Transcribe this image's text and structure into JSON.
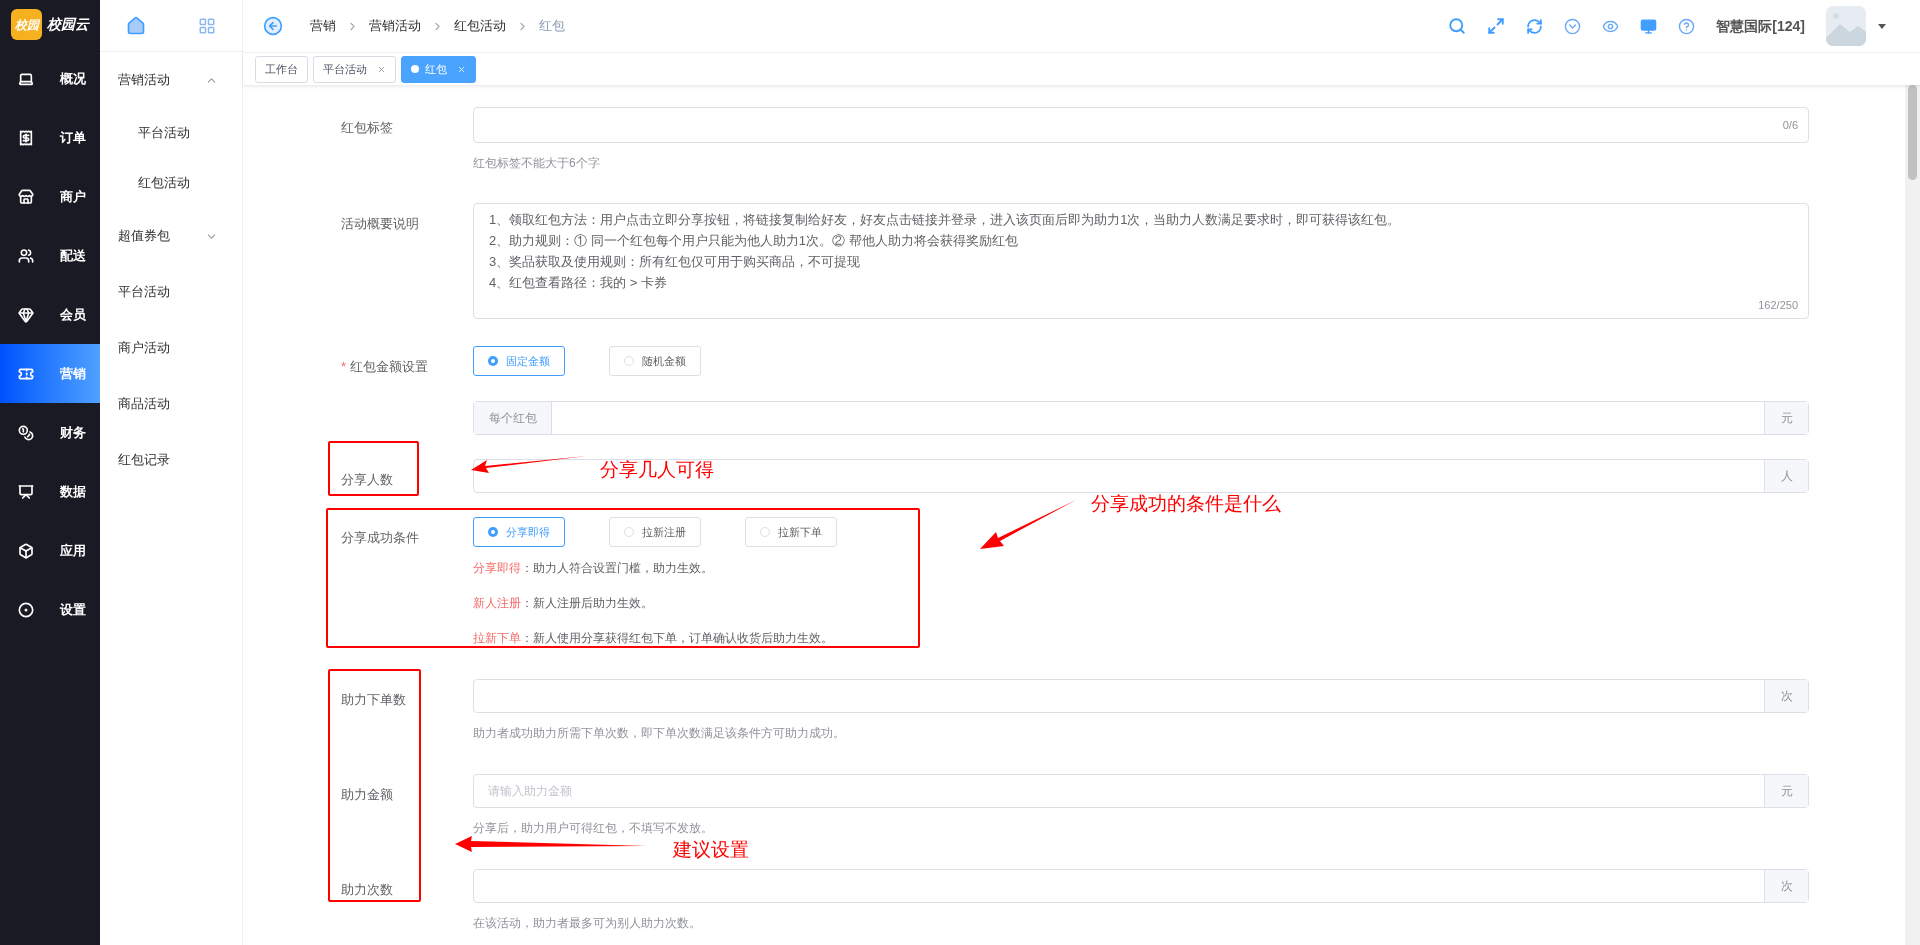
{
  "logo": {
    "mark": "校园",
    "name": "校园云"
  },
  "rail": [
    {
      "label": "概况",
      "selected": false
    },
    {
      "label": "订单",
      "selected": false
    },
    {
      "label": "商户",
      "selected": false
    },
    {
      "label": "配送",
      "selected": false
    },
    {
      "label": "会员",
      "selected": false
    },
    {
      "label": "营销",
      "selected": true
    },
    {
      "label": "财务",
      "selected": false
    },
    {
      "label": "数据",
      "selected": false
    },
    {
      "label": "应用",
      "selected": false
    },
    {
      "label": "设置",
      "selected": false
    }
  ],
  "subnav": [
    {
      "label": "营销活动",
      "expanded": true,
      "children": [
        {
          "label": "平台活动"
        },
        {
          "label": "红包活动"
        }
      ]
    },
    {
      "label": "超值券包",
      "expanded": false
    },
    {
      "label": "平台活动"
    },
    {
      "label": "商户活动"
    },
    {
      "label": "商品活动"
    },
    {
      "label": "红包记录"
    }
  ],
  "breadcrumb": [
    "营销",
    "营销活动",
    "红包活动",
    "红包"
  ],
  "user": "智慧国际[124]",
  "tabs": [
    {
      "label": "工作台",
      "selected": false,
      "closable": false
    },
    {
      "label": "平台活动",
      "selected": false,
      "closable": true
    },
    {
      "label": "红包",
      "selected": true,
      "closable": true
    }
  ],
  "form": [
    {
      "kind": "text",
      "label": "红包标签",
      "counter": "0/6",
      "hint": "红包标签不能大于6个字"
    },
    {
      "kind": "textarea",
      "label": "活动概要说明",
      "lines": [
        "1、领取红包方法：用户点击立即分享按钮，将链接复制给好友，好友点击链接并登录，进入该页面后即为助力1次，当助力人数满足要求时，即可获得该红包。",
        "2、助力规则：① 同一个红包每个用户只能为他人助力1次。② 帮他人助力将会获得奖励红包",
        "3、奖品获取及使用规则：所有红包仅可用于购买商品，不可提现",
        "4、红包查看路径：我的 > 卡券"
      ],
      "counter": "162/250"
    },
    {
      "kind": "radio",
      "label": "红包金额设置",
      "required_mark": "*",
      "options": [
        {
          "label": "固定金额",
          "selected": true
        },
        {
          "label": "随机金额",
          "selected": false
        }
      ]
    },
    {
      "kind": "group",
      "prefix": "每个红包",
      "suffix": "元"
    },
    {
      "kind": "group",
      "label": "分享人数",
      "suffix": "人"
    },
    {
      "kind": "radio",
      "label": "分享成功条件",
      "options": [
        {
          "label": "分享即得",
          "selected": true
        },
        {
          "label": "拉新注册",
          "selected": false
        },
        {
          "label": "拉新下单",
          "selected": false
        }
      ],
      "notes": [
        {
          "term": "分享即得",
          "text": "：助力人符合设置门槛，助力生效。"
        },
        {
          "term": "新人注册",
          "text": "：新人注册后助力生效。"
        },
        {
          "term": "拉新下单",
          "text": "：新人使用分享获得红包下单，订单确认收货后助力生效。"
        }
      ]
    },
    {
      "kind": "group",
      "label": "助力下单数",
      "suffix": "次",
      "hint": "助力者成功助力所需下单次数，即下单次数满足该条件方可助力成功。"
    },
    {
      "kind": "group",
      "label": "助力金额",
      "suffix": "元",
      "placeholder": "请输入助力金额",
      "hint": "分享后，助力用户可得红包，不填写不发放。"
    },
    {
      "kind": "group",
      "label": "助力次数",
      "suffix": "次",
      "hint": "在该活动，助力者最多可为别人助力次数。"
    }
  ],
  "annotations": [
    "分享几人可得",
    "分享成功的条件是什么",
    "建议设置"
  ]
}
